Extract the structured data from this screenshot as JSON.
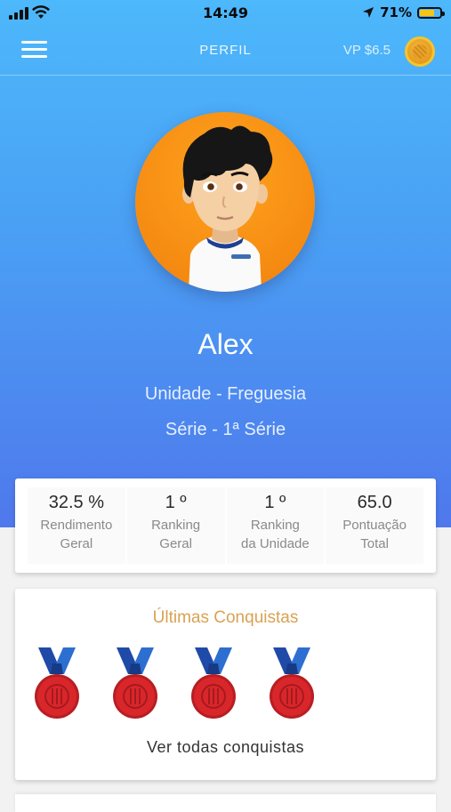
{
  "status_bar": {
    "time": "14:49",
    "battery": "71%",
    "battery_level": 0.71
  },
  "header": {
    "title": "PERFIL",
    "balance": "VP $6.5",
    "menu_icon": "hamburger-menu-icon",
    "coin_icon": "coin-icon"
  },
  "profile": {
    "name": "Alex",
    "unit": "Unidade - Freguesia",
    "grade": "Série - 1ª Série"
  },
  "stats": [
    {
      "value": "32.5 %",
      "label": "Rendimento\nGeral"
    },
    {
      "value": "1 º",
      "label": "Ranking\nGeral"
    },
    {
      "value": "1 º",
      "label": "Ranking\nda Unidade"
    },
    {
      "value": "65.0",
      "label": "Pontuação\nTotal"
    }
  ],
  "achievements": {
    "title": "Últimas Conquistas",
    "see_all_label": "Ver todas conquistas",
    "medal_count": 4
  },
  "colors": {
    "accent_gold": "#d9a253",
    "gradient_top": "#4db8fb",
    "gradient_bottom": "#4f78ec",
    "avatar_bg": "#f58b12",
    "medal_red": "#d9262b",
    "ribbon_blue": "#1f4aa8"
  }
}
